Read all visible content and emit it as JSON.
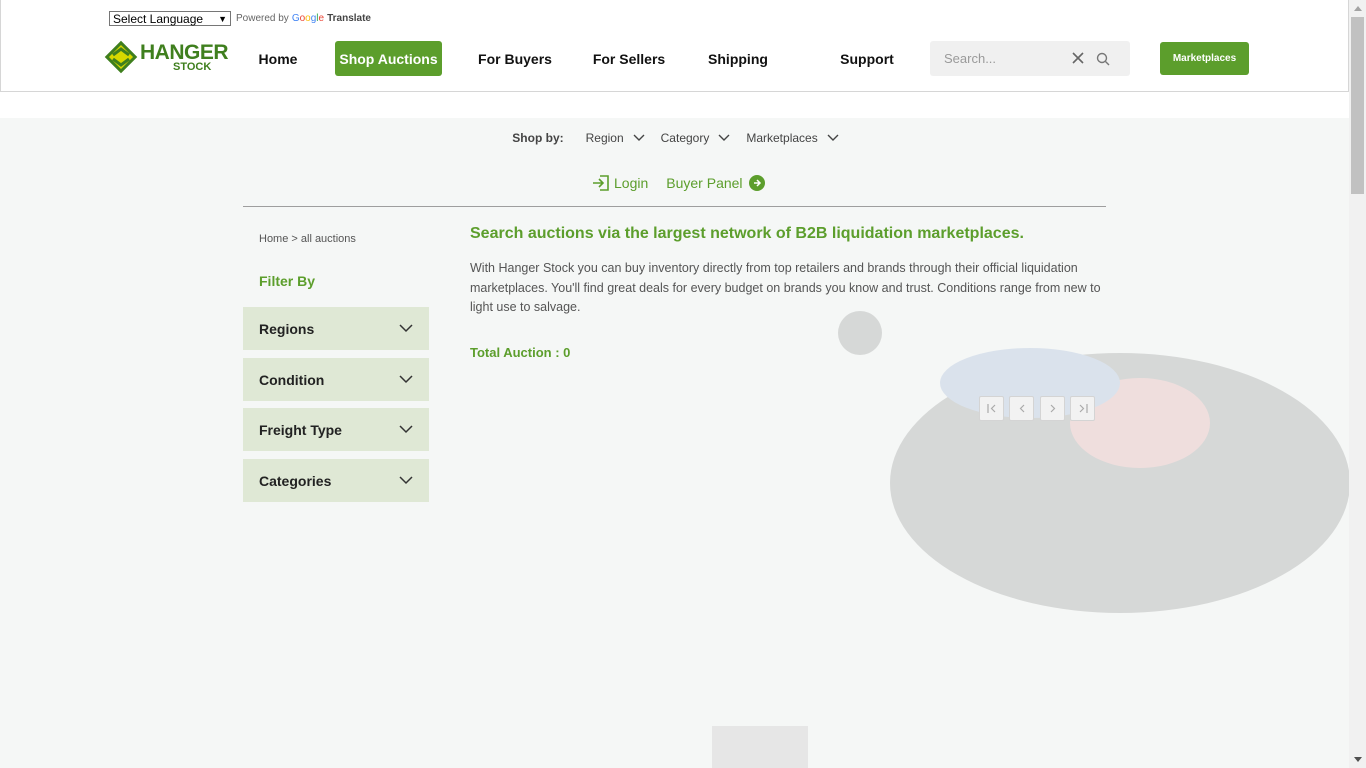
{
  "translate": {
    "select_label": "Select Language",
    "powered_by": "Powered by",
    "google_letters": [
      "G",
      "o",
      "o",
      "g",
      "l",
      "e"
    ],
    "translate_word": "Translate"
  },
  "logo": {
    "line1": "HANGER",
    "line2": "STOCK"
  },
  "nav": {
    "items": [
      {
        "label": "Home",
        "active": false
      },
      {
        "label": "Shop Auctions",
        "active": true
      },
      {
        "label": "For Buyers",
        "active": false
      },
      {
        "label": "For Sellers",
        "active": false
      },
      {
        "label": "Shipping",
        "active": false
      },
      {
        "label": "Support",
        "active": false
      }
    ]
  },
  "search": {
    "placeholder": "Search..."
  },
  "marketplaces_button": "Marketplaces",
  "shop_by": {
    "label": "Shop by:",
    "dropdowns": [
      "Region",
      "Category",
      "Marketplaces"
    ]
  },
  "auth": {
    "login": "Login",
    "buyer_panel": "Buyer Panel"
  },
  "breadcrumb": "Home > all auctions",
  "filter": {
    "title": "Filter By",
    "groups": [
      "Regions",
      "Condition",
      "Freight Type",
      "Categories"
    ]
  },
  "content": {
    "headline": "Search auctions via the largest network of B2B liquidation marketplaces.",
    "description": "With Hanger Stock you can buy inventory directly from top retailers and brands through their official liquidation marketplaces. You'll find great deals for every budget on brands you know and trust. Conditions range from new to light use to salvage.",
    "total_label": "Total Auction : 0"
  },
  "colors": {
    "brand_green": "#5c9e2c",
    "accordion_bg": "#dfe8d5",
    "logo_yellow": "#d6d800"
  }
}
